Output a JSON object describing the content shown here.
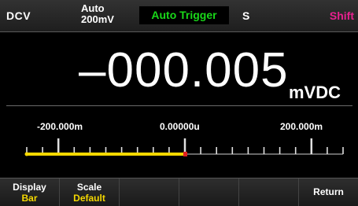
{
  "status_bar": {
    "mode": "DCV",
    "range_line1": "Auto",
    "range_line2": "200mV",
    "trigger": "Auto Trigger",
    "flag_s": "S",
    "flag_shift": "Shift"
  },
  "measurement": {
    "value": "–000.005",
    "unit": "mVDC"
  },
  "bar_graph": {
    "left_label": "-200.000m",
    "center_label": "0.00000u",
    "right_label": "200.000m",
    "min": -200,
    "max": 200,
    "value": -0.005
  },
  "softkeys": [
    {
      "label": "Display",
      "value": "Bar"
    },
    {
      "label": "Scale",
      "value": "Default"
    },
    {
      "label": "",
      "value": ""
    },
    {
      "label": "",
      "value": ""
    },
    {
      "label": "",
      "value": ""
    },
    {
      "label": "Return",
      "value": ""
    }
  ],
  "colors": {
    "trigger_text": "#19d819",
    "shift_text": "#e8208f",
    "softkey_value": "#f5d800",
    "bar_fill": "#f5d800",
    "bar_marker": "#e02020"
  }
}
